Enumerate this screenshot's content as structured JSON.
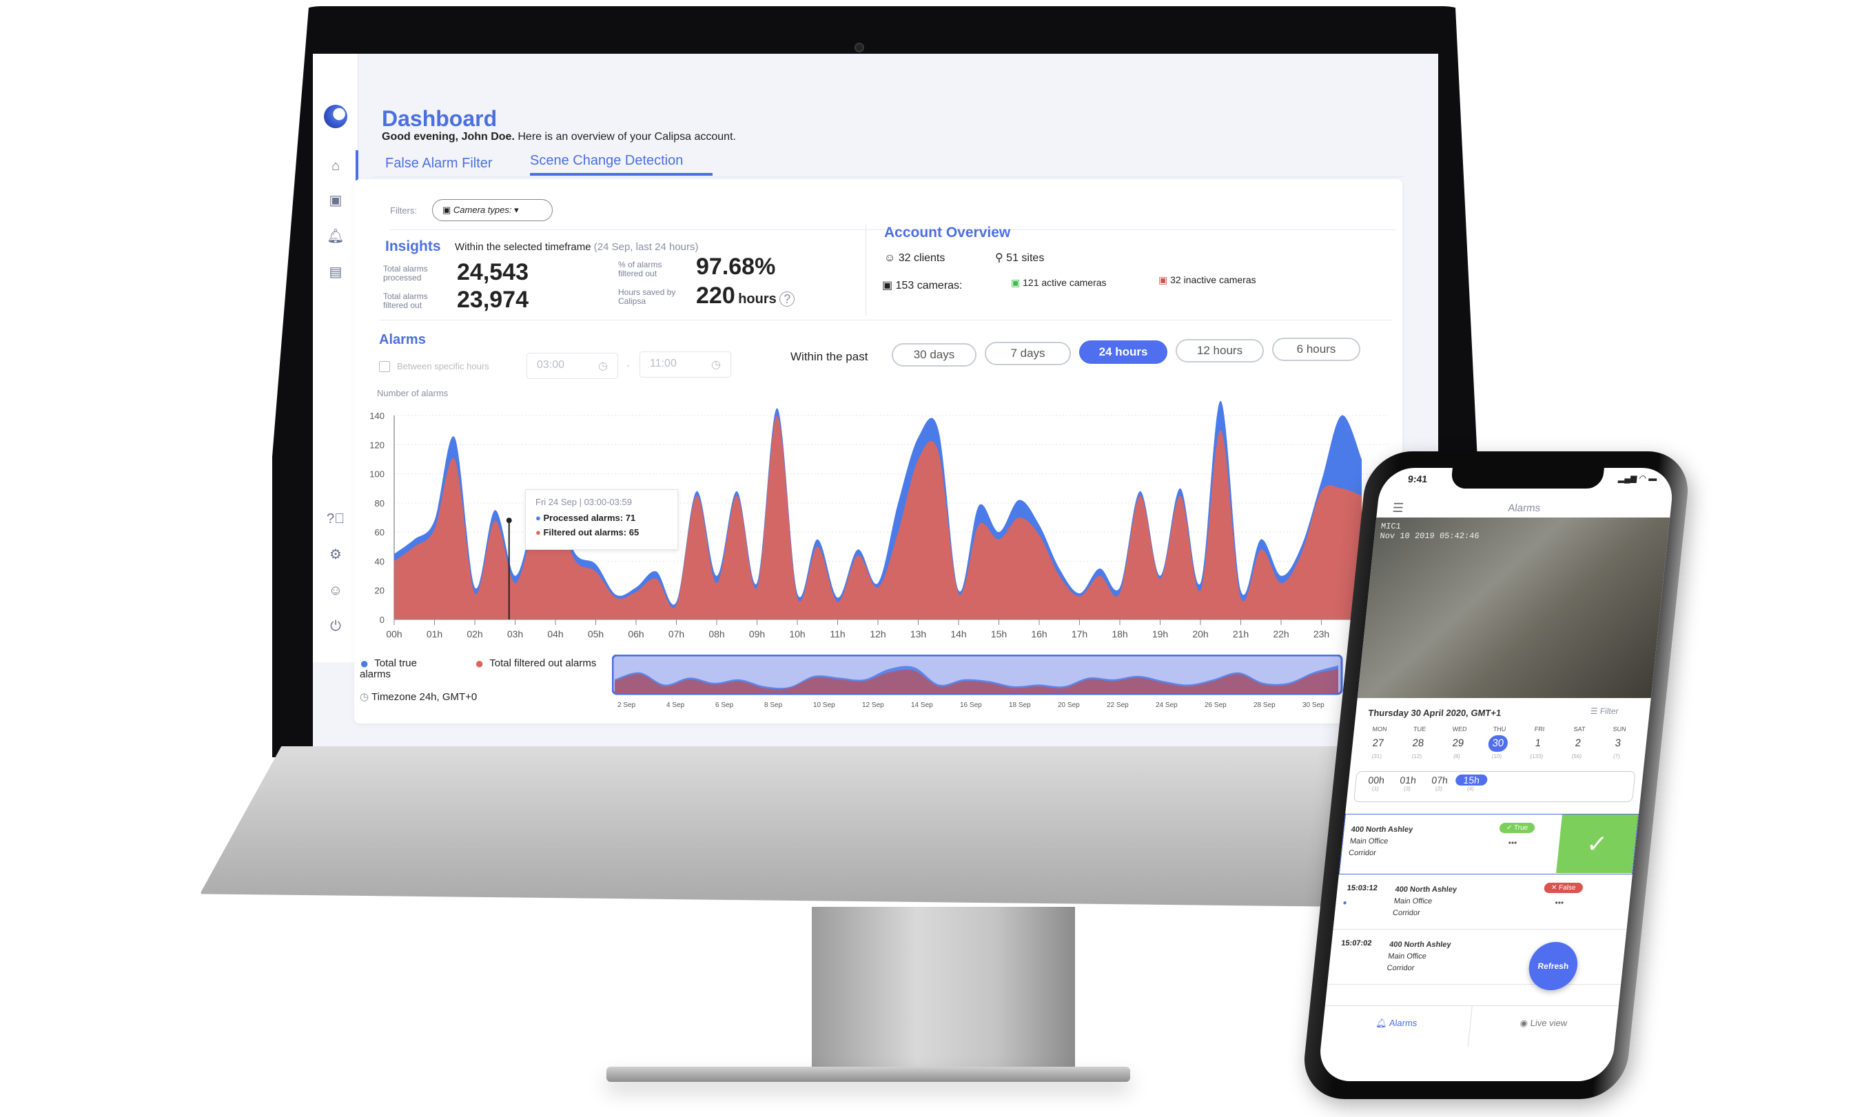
{
  "header": {
    "title": "Dashboard",
    "greeting": "Good evening, John Doe.",
    "subtitle": "Here is an overview of your Calipsa account."
  },
  "tabs": [
    {
      "label": "False Alarm Filter",
      "active": false
    },
    {
      "label": "Scene Change Detection",
      "active": true
    }
  ],
  "sidebar": {
    "icons": [
      "home-icon",
      "camera-icon",
      "bell-icon",
      "clipboard-icon"
    ],
    "bottom_icons": [
      "help-icon",
      "gear-icon",
      "user-icon",
      "power-icon"
    ]
  },
  "filters": {
    "label": "Filters:",
    "camera_types": "Camera types:"
  },
  "insights": {
    "title": "Insights",
    "subtitle": "Within the selected timeframe",
    "timeframe": "(24 Sep, last 24 hours)",
    "processed_label": "Total alarms processed",
    "processed": "24,543",
    "filtered_label": "Total alarms filtered out",
    "filtered": "23,974",
    "pct_label": "% of alarms filtered out",
    "pct": "97.68%",
    "hours_label": "Hours saved by Calipsa",
    "hours": "220",
    "hours_unit": "hours"
  },
  "account": {
    "title": "Account Overview",
    "clients": "32 clients",
    "sites": "51 sites",
    "cameras": "153 cameras:",
    "active": "121 active cameras",
    "inactive": "32 inactive cameras"
  },
  "alarms": {
    "title": "Alarms",
    "between_label": "Between specific hours",
    "from": "03:00",
    "to": "11:00",
    "dash": "-",
    "within_label": "Within the past",
    "ranges": [
      {
        "label": "30 days",
        "active": false
      },
      {
        "label": "7 days",
        "active": false
      },
      {
        "label": "24 hours",
        "active": true
      },
      {
        "label": "12 hours",
        "active": false
      },
      {
        "label": "6 hours",
        "active": false
      }
    ],
    "legend": [
      {
        "label": "Total true alarms",
        "color": "#4a7be8"
      },
      {
        "label": "Total filtered out alarms",
        "color": "#d9665e"
      }
    ],
    "timezone": "Timezone 24h, GMT+0",
    "tooltip": {
      "title": "Fri 24 Sep | 03:00-03:59",
      "processed": "Processed alarms: 71",
      "filtered": "Filtered out alarms: 65"
    }
  },
  "chart_data": [
    {
      "type": "area",
      "ylabel": "Number of alarms",
      "ylim": [
        0,
        140
      ],
      "yticks": [
        0,
        20,
        40,
        60,
        80,
        100,
        120,
        140
      ],
      "grid": true,
      "xticks": [
        "00h",
        "01h",
        "02h",
        "03h",
        "04h",
        "05h",
        "06h",
        "07h",
        "08h",
        "09h",
        "10h",
        "11h",
        "12h",
        "13h",
        "14h",
        "15h",
        "16h",
        "17h",
        "18h",
        "19h",
        "20h",
        "21h",
        "22h",
        "23h"
      ],
      "x_hours": [
        0,
        0.5,
        1,
        1.5,
        2,
        2.5,
        3,
        3.5,
        4,
        4.5,
        5,
        5.5,
        6,
        6.5,
        7,
        7.5,
        8,
        8.5,
        9,
        9.5,
        10,
        10.5,
        11,
        11.5,
        12,
        12.5,
        13,
        13.5,
        14,
        14.5,
        15,
        15.5,
        16,
        16.5,
        17,
        17.5,
        18,
        18.5,
        19,
        19.5,
        20,
        20.5,
        21,
        21.5,
        22,
        22.5,
        23,
        23.5,
        24
      ],
      "series": [
        {
          "name": "Processed alarms",
          "color": "#4a7be8",
          "values": [
            45,
            55,
            68,
            125,
            22,
            75,
            30,
            71,
            78,
            45,
            38,
            17,
            22,
            33,
            12,
            88,
            30,
            88,
            25,
            145,
            18,
            55,
            15,
            48,
            25,
            80,
            125,
            130,
            20,
            78,
            60,
            82,
            65,
            35,
            18,
            35,
            22,
            88,
            30,
            90,
            25,
            150,
            20,
            55,
            30,
            50,
            95,
            140,
            110
          ]
        },
        {
          "name": "Filtered out alarms",
          "color": "#d9665e",
          "values": [
            40,
            50,
            62,
            110,
            18,
            68,
            25,
            65,
            72,
            40,
            33,
            15,
            19,
            28,
            10,
            85,
            25,
            85,
            22,
            140,
            15,
            50,
            12,
            44,
            22,
            60,
            110,
            115,
            18,
            65,
            55,
            70,
            58,
            30,
            16,
            30,
            18,
            85,
            28,
            85,
            20,
            130,
            15,
            48,
            25,
            45,
            88,
            90,
            85
          ]
        }
      ]
    },
    {
      "type": "area",
      "xticks": [
        "2 Sep",
        "4 Sep",
        "6 Sep",
        "8 Sep",
        "10 Sep",
        "12 Sep",
        "14 Sep",
        "16 Sep",
        "18 Sep",
        "20 Sep",
        "22 Sep",
        "24 Sep",
        "26 Sep",
        "28 Sep",
        "30 Sep"
      ],
      "series": [
        {
          "name": "Total true alarms",
          "values": [
            40,
            60,
            25,
            45,
            30,
            40,
            20,
            18,
            50,
            45,
            40,
            70,
            75,
            25,
            40,
            35,
            20,
            25,
            20,
            45,
            40,
            50,
            35,
            25,
            40,
            60,
            30,
            30,
            60,
            80
          ]
        },
        {
          "name": "Total filtered out alarms",
          "values": [
            35,
            55,
            20,
            40,
            25,
            35,
            15,
            15,
            45,
            40,
            35,
            60,
            65,
            20,
            35,
            30,
            15,
            20,
            15,
            40,
            35,
            45,
            30,
            20,
            35,
            55,
            25,
            25,
            55,
            70
          ]
        }
      ]
    }
  ],
  "phone": {
    "time": "9:41",
    "title": "Alarms",
    "cam_id": "MIC1",
    "cam_time": "Nov 10 2019 05:42:46",
    "date": "Thursday 30 April 2020, GMT+1",
    "filter": "Filter",
    "days": [
      {
        "name": "MON",
        "num": "27",
        "count": "(31)"
      },
      {
        "name": "TUE",
        "num": "28",
        "count": "(12)"
      },
      {
        "name": "WED",
        "num": "29",
        "count": "(8)"
      },
      {
        "name": "THU",
        "num": "30",
        "count": "(10)",
        "active": true
      },
      {
        "name": "FRI",
        "num": "1",
        "count": "(133)"
      },
      {
        "name": "SAT",
        "num": "2",
        "count": "(56)"
      },
      {
        "name": "SUN",
        "num": "3",
        "count": "(7)"
      }
    ],
    "hours": [
      {
        "h": "00h",
        "c": "(1)"
      },
      {
        "h": "01h",
        "c": "(3)"
      },
      {
        "h": "07h",
        "c": "(2)"
      },
      {
        "h": "15h",
        "c": "(4)",
        "active": true
      }
    ],
    "items": [
      {
        "time": "",
        "site": "400 North Ashley",
        "place": "Main Office",
        "zone": "Corridor",
        "badge": "✓ True"
      },
      {
        "time": "15:03:12",
        "site": "400 North Ashley",
        "place": "Main Office",
        "zone": "Corridor",
        "badge": "✕ False"
      },
      {
        "time": "15:07:02",
        "site": "400 North Ashley",
        "place": "Main Office",
        "zone": "Corridor",
        "badge": ""
      }
    ],
    "more": "•••",
    "refresh": "Refresh",
    "nav": [
      {
        "label": "Alarms"
      },
      {
        "label": "Live view"
      }
    ]
  },
  "colors": {
    "accent": "#4b6fe0",
    "processed": "#4a7be8",
    "filtered": "#d9665e",
    "true": "#7ccf5a",
    "false": "#d9534f"
  }
}
